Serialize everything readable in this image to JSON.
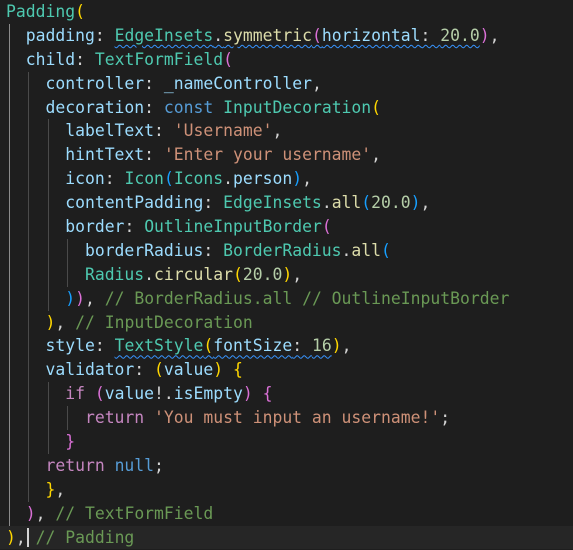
{
  "colors": {
    "background": "#1e1e1e",
    "current_line": "#262626",
    "indent_guide": "#4a4a4a",
    "active_indent_guide": "#8a8a8a",
    "class": "#4ec9b0",
    "property": "#9cdcfe",
    "function": "#dcdcaa",
    "string": "#ce9178",
    "number": "#b5cea8",
    "keyword": "#569cd6",
    "control": "#c586c0",
    "comment": "#6a9955",
    "bracket1": "#ffd700",
    "bracket2": "#da70d6",
    "bracket3": "#179fff",
    "plain": "#d4d4d4"
  },
  "lines": [
    {
      "indent": 0,
      "tokens": [
        {
          "t": "Padding",
          "c": "class"
        },
        {
          "t": "(",
          "c": "bracket1"
        }
      ]
    },
    {
      "indent": 1,
      "tokens": [
        {
          "t": "padding",
          "c": "property"
        },
        {
          "t": ": ",
          "c": "plain"
        },
        {
          "t": "EdgeInsets",
          "c": "class",
          "s": true
        },
        {
          "t": ".",
          "c": "plain",
          "s": true
        },
        {
          "t": "symmetric",
          "c": "function",
          "s": true
        },
        {
          "t": "(",
          "c": "bracket2",
          "s": true
        },
        {
          "t": "horizontal",
          "c": "property",
          "s": true
        },
        {
          "t": ": ",
          "c": "plain",
          "s": true
        },
        {
          "t": "20.0",
          "c": "number",
          "s": true
        },
        {
          "t": ")",
          "c": "bracket2"
        },
        {
          "t": ",",
          "c": "plain"
        }
      ]
    },
    {
      "indent": 1,
      "tokens": [
        {
          "t": "child",
          "c": "property"
        },
        {
          "t": ": ",
          "c": "plain"
        },
        {
          "t": "TextFormField",
          "c": "class"
        },
        {
          "t": "(",
          "c": "bracket2"
        }
      ]
    },
    {
      "indent": 2,
      "tokens": [
        {
          "t": "controller",
          "c": "property"
        },
        {
          "t": ": ",
          "c": "plain"
        },
        {
          "t": "_nameController",
          "c": "property"
        },
        {
          "t": ",",
          "c": "plain"
        }
      ]
    },
    {
      "indent": 2,
      "tokens": [
        {
          "t": "decoration",
          "c": "property"
        },
        {
          "t": ": ",
          "c": "plain"
        },
        {
          "t": "const ",
          "c": "keyword"
        },
        {
          "t": "InputDecoration",
          "c": "class"
        },
        {
          "t": "(",
          "c": "bracket1"
        }
      ]
    },
    {
      "indent": 3,
      "tokens": [
        {
          "t": "labelText",
          "c": "property"
        },
        {
          "t": ": ",
          "c": "plain"
        },
        {
          "t": "'Username'",
          "c": "string"
        },
        {
          "t": ",",
          "c": "plain"
        }
      ]
    },
    {
      "indent": 3,
      "tokens": [
        {
          "t": "hintText",
          "c": "property"
        },
        {
          "t": ": ",
          "c": "plain"
        },
        {
          "t": "'Enter your username'",
          "c": "string"
        },
        {
          "t": ",",
          "c": "plain"
        }
      ]
    },
    {
      "indent": 3,
      "tokens": [
        {
          "t": "icon",
          "c": "property"
        },
        {
          "t": ": ",
          "c": "plain"
        },
        {
          "t": "Icon",
          "c": "class"
        },
        {
          "t": "(",
          "c": "bracket3"
        },
        {
          "t": "Icons",
          "c": "class"
        },
        {
          "t": ".",
          "c": "plain"
        },
        {
          "t": "person",
          "c": "property"
        },
        {
          "t": ")",
          "c": "bracket3"
        },
        {
          "t": ",",
          "c": "plain"
        }
      ]
    },
    {
      "indent": 3,
      "tokens": [
        {
          "t": "contentPadding",
          "c": "property"
        },
        {
          "t": ": ",
          "c": "plain"
        },
        {
          "t": "EdgeInsets",
          "c": "class"
        },
        {
          "t": ".",
          "c": "plain"
        },
        {
          "t": "all",
          "c": "function"
        },
        {
          "t": "(",
          "c": "bracket3"
        },
        {
          "t": "20.0",
          "c": "number"
        },
        {
          "t": ")",
          "c": "bracket3"
        },
        {
          "t": ",",
          "c": "plain"
        }
      ]
    },
    {
      "indent": 3,
      "tokens": [
        {
          "t": "border",
          "c": "property"
        },
        {
          "t": ": ",
          "c": "plain"
        },
        {
          "t": "OutlineInputBorder",
          "c": "class"
        },
        {
          "t": "(",
          "c": "bracket2"
        }
      ]
    },
    {
      "indent": 4,
      "tokens": [
        {
          "t": "borderRadius",
          "c": "property"
        },
        {
          "t": ": ",
          "c": "plain"
        },
        {
          "t": "BorderRadius",
          "c": "class"
        },
        {
          "t": ".",
          "c": "plain"
        },
        {
          "t": "all",
          "c": "function"
        },
        {
          "t": "(",
          "c": "bracket3"
        }
      ]
    },
    {
      "indent": 4,
      "tokens": [
        {
          "t": "Radius",
          "c": "class"
        },
        {
          "t": ".",
          "c": "plain"
        },
        {
          "t": "circular",
          "c": "function"
        },
        {
          "t": "(",
          "c": "bracket1"
        },
        {
          "t": "20.0",
          "c": "number"
        },
        {
          "t": ")",
          "c": "bracket1"
        },
        {
          "t": ",",
          "c": "plain"
        }
      ]
    },
    {
      "indent": 3,
      "tokens": [
        {
          "t": ")",
          "c": "bracket3"
        },
        {
          "t": ")",
          "c": "bracket2"
        },
        {
          "t": ", ",
          "c": "plain"
        },
        {
          "t": "// BorderRadius.all // OutlineInputBorder",
          "c": "comment"
        }
      ]
    },
    {
      "indent": 2,
      "tokens": [
        {
          "t": ")",
          "c": "bracket1"
        },
        {
          "t": ", ",
          "c": "plain"
        },
        {
          "t": "// InputDecoration",
          "c": "comment"
        }
      ]
    },
    {
      "indent": 2,
      "tokens": [
        {
          "t": "style",
          "c": "property"
        },
        {
          "t": ": ",
          "c": "plain"
        },
        {
          "t": "TextStyle",
          "c": "class",
          "s": true
        },
        {
          "t": "(",
          "c": "bracket1",
          "s": true
        },
        {
          "t": "fontSize",
          "c": "property",
          "s": true
        },
        {
          "t": ": ",
          "c": "plain",
          "s": true
        },
        {
          "t": "16",
          "c": "number",
          "s": true
        },
        {
          "t": ")",
          "c": "bracket1"
        },
        {
          "t": ",",
          "c": "plain"
        }
      ]
    },
    {
      "indent": 2,
      "tokens": [
        {
          "t": "validator",
          "c": "property"
        },
        {
          "t": ": ",
          "c": "plain"
        },
        {
          "t": "(",
          "c": "bracket1"
        },
        {
          "t": "value",
          "c": "property"
        },
        {
          "t": ")",
          "c": "bracket1"
        },
        {
          "t": " ",
          "c": "plain"
        },
        {
          "t": "{",
          "c": "bracket1"
        }
      ]
    },
    {
      "indent": 3,
      "tokens": [
        {
          "t": "if ",
          "c": "control"
        },
        {
          "t": "(",
          "c": "bracket2"
        },
        {
          "t": "value",
          "c": "property"
        },
        {
          "t": "!.",
          "c": "plain"
        },
        {
          "t": "isEmpty",
          "c": "property"
        },
        {
          "t": ")",
          "c": "bracket2"
        },
        {
          "t": " ",
          "c": "plain"
        },
        {
          "t": "{",
          "c": "bracket2"
        }
      ]
    },
    {
      "indent": 4,
      "tokens": [
        {
          "t": "return ",
          "c": "control"
        },
        {
          "t": "'You must input an username!'",
          "c": "string"
        },
        {
          "t": ";",
          "c": "plain"
        }
      ]
    },
    {
      "indent": 3,
      "tokens": [
        {
          "t": "}",
          "c": "bracket2"
        }
      ]
    },
    {
      "indent": 2,
      "tokens": [
        {
          "t": "return ",
          "c": "control"
        },
        {
          "t": "null",
          "c": "keyword"
        },
        {
          "t": ";",
          "c": "plain"
        }
      ]
    },
    {
      "indent": 2,
      "tokens": [
        {
          "t": "}",
          "c": "bracket1"
        },
        {
          "t": ",",
          "c": "plain"
        }
      ]
    },
    {
      "indent": 1,
      "tokens": [
        {
          "t": ")",
          "c": "bracket2"
        },
        {
          "t": ", ",
          "c": "plain"
        },
        {
          "t": "// TextFormField",
          "c": "comment"
        }
      ]
    },
    {
      "indent": 0,
      "current": true,
      "cursor_after": 1,
      "tokens": [
        {
          "t": ")",
          "c": "bracket1"
        },
        {
          "t": ",",
          "c": "plain"
        },
        {
          "t": " ",
          "c": "plain"
        },
        {
          "t": "// Padding",
          "c": "comment"
        }
      ]
    }
  ]
}
